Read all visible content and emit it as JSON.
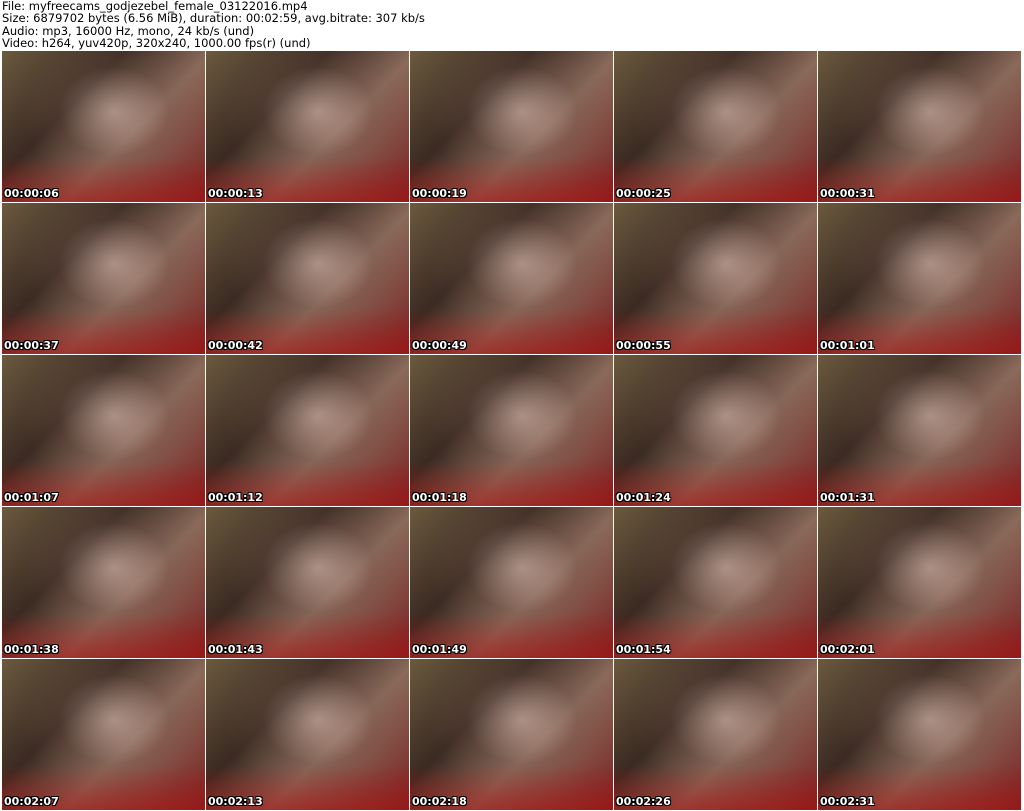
{
  "header": {
    "file": "File: myfreecams_godjezebel_female_03122016.mp4",
    "size": "Size: 6879702 bytes (6.56 MiB), duration: 00:02:59, avg.bitrate: 307 kb/s",
    "audio": "Audio: mp3, 16000 Hz, mono, 24 kb/s (und)",
    "video": "Video: h264, yuv420p, 320x240, 1000.00 fps(r) (und)"
  },
  "frames": [
    "00:00:06",
    "00:00:13",
    "00:00:19",
    "00:00:25",
    "00:00:31",
    "00:00:37",
    "00:00:42",
    "00:00:49",
    "00:00:55",
    "00:01:01",
    "00:01:07",
    "00:01:12",
    "00:01:18",
    "00:01:24",
    "00:01:31",
    "00:01:38",
    "00:01:43",
    "00:01:49",
    "00:01:54",
    "00:02:01",
    "00:02:07",
    "00:02:13",
    "00:02:18",
    "00:02:26",
    "00:02:31"
  ]
}
